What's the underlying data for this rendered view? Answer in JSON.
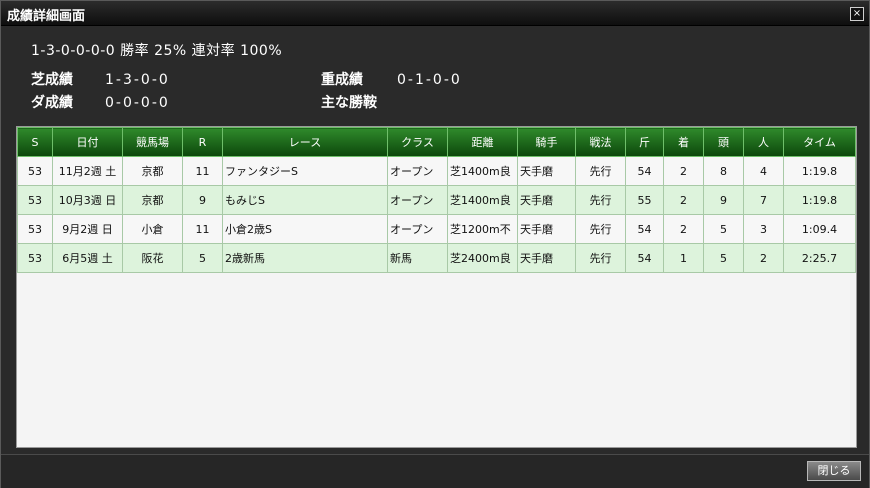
{
  "window": {
    "title": "成績詳細画面",
    "close_glyph": "×"
  },
  "summary": "1-3-0-0-0-0 勝率 25% 連対率 100%",
  "stats": {
    "turf_label": "芝成績",
    "turf_value": "1-3-0-0",
    "dirt_label": "ダ成績",
    "dirt_value": "0-0-0-0",
    "heavy_label": "重成績",
    "heavy_value": "0-1-0-0",
    "main_label": "主な勝鞍",
    "main_value": ""
  },
  "table": {
    "headers": [
      "S",
      "日付",
      "競馬場",
      "R",
      "レース",
      "クラス",
      "距離",
      "騎手",
      "戦法",
      "斤",
      "着",
      "頭",
      "人",
      "タイム"
    ],
    "rows": [
      [
        "53",
        "11月2週 土",
        "京都",
        "11",
        "ファンタジーS",
        "オープン",
        "芝1400m良",
        "天手磨",
        "先行",
        "54",
        "2",
        "8",
        "4",
        "1:19.8"
      ],
      [
        "53",
        "10月3週 日",
        "京都",
        "9",
        "もみじS",
        "オープン",
        "芝1400m良",
        "天手磨",
        "先行",
        "55",
        "2",
        "9",
        "7",
        "1:19.8"
      ],
      [
        "53",
        "9月2週 日",
        "小倉",
        "11",
        "小倉2歳S",
        "オープン",
        "芝1200m不",
        "天手磨",
        "先行",
        "54",
        "2",
        "5",
        "3",
        "1:09.4"
      ],
      [
        "53",
        "6月5週 土",
        "阪花",
        "5",
        "2歳新馬",
        "新馬",
        "芝2400m良",
        "天手磨",
        "先行",
        "54",
        "1",
        "5",
        "2",
        "2:25.7"
      ]
    ]
  },
  "footer": {
    "close_label": "閉じる"
  }
}
